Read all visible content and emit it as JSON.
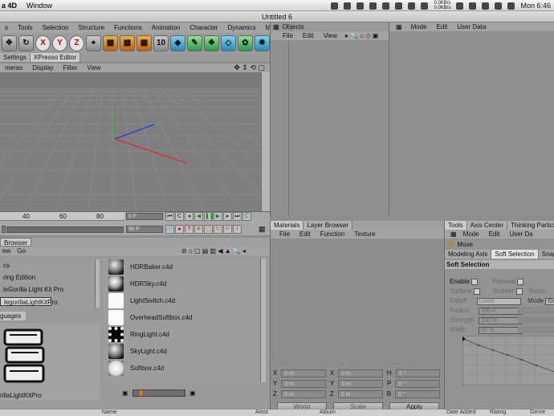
{
  "menubar": {
    "app_name": "a 4D",
    "items": [
      "Window"
    ],
    "network": {
      "up": "0.0KB/s",
      "down": "0.0KB/s"
    },
    "clock": "Mon 6:46"
  },
  "window": {
    "title": "Untitled 6"
  },
  "main_menu": [
    "s",
    "Tools",
    "Selection",
    "Structure",
    "Functions",
    "Animation",
    "Character",
    "Dynamics",
    "MoC"
  ],
  "toolbar": {
    "x_label": "X",
    "y_label": "Y",
    "z_label": "Z",
    "counter": "10"
  },
  "left_tabs": [
    "Settings",
    "XPresso Editor"
  ],
  "viewport_menu": [
    "meras",
    "Display",
    "Filter",
    "View"
  ],
  "timeline": {
    "ruler": [
      "40",
      "60",
      "80"
    ],
    "current_frame": "0 F",
    "end_frame": "90 F",
    "min_frame": "0 F",
    "max_frame": "90 F"
  },
  "content_browser": {
    "tab": "Browser",
    "menu": [
      "ew",
      "Go"
    ],
    "tree": [
      {
        "label": "cs",
        "selected": false
      },
      {
        "label": "ring Edition",
        "selected": false
      },
      {
        "label": "leGorilla Light Kit Pro",
        "selected": false
      },
      {
        "label": "legorillaLightKitPro",
        "selected": true
      }
    ],
    "languages_label": "guages",
    "preview_caption": "rillaLightKitPro",
    "files": [
      {
        "name": "HDRBaker.c4d",
        "thumb": "sphere"
      },
      {
        "name": "HDRSky.c4d",
        "thumb": "sky"
      },
      {
        "name": "LightSwitch.c4d",
        "thumb": "light"
      },
      {
        "name": "OverheadSoftbox.c4d",
        "thumb": "light"
      },
      {
        "name": "RingLight.c4d",
        "thumb": "ring"
      },
      {
        "name": "SkyLight.c4d",
        "thumb": "sphere"
      },
      {
        "name": "Softbox.c4d",
        "thumb": "soft"
      }
    ]
  },
  "objects_panel": {
    "title": "Objects",
    "menu": [
      "File",
      "Edit",
      "View"
    ]
  },
  "attributes_panel": {
    "menu": [
      "Mode",
      "Edit",
      "User Data"
    ]
  },
  "materials_panel": {
    "tabs": [
      "Materials",
      "Layer Browser"
    ],
    "menu": [
      "File",
      "Edit",
      "Function",
      "Texture"
    ]
  },
  "coordinates": {
    "col_headers": [
      "---",
      "---",
      "---"
    ],
    "rows": [
      {
        "a": "X",
        "av": "0 m",
        "b": "X",
        "bv": "0 m",
        "c": "H",
        "cv": "0 °"
      },
      {
        "a": "Y",
        "av": "0 m",
        "b": "Y",
        "bv": "0 m",
        "c": "P",
        "cv": "0 °"
      },
      {
        "a": "Z",
        "av": "0 m",
        "b": "Z",
        "bv": "0 m",
        "c": "B",
        "cv": "0 °"
      }
    ],
    "world": "World",
    "scale": "Scale",
    "apply": "Apply"
  },
  "tools_panel": {
    "tabs": [
      "Tools",
      "Axis Center",
      "Thinking Particles"
    ],
    "menu": [
      "Mode",
      "Edit",
      "User Da"
    ],
    "tool_name": "Move",
    "sub_tabs": [
      "Modeling Axis",
      "Soft Selection",
      "Snap Se"
    ],
    "section": "Soft Selection",
    "enable": "Enable",
    "preview": "Preview",
    "surface": "Surface",
    "rubber": "Rubber",
    "restrict": "Restri",
    "falloff": "Falloff",
    "falloff_value": "Linear",
    "mode": "Mode",
    "mode_value": "Gr",
    "radius": "Radius",
    "radius_value": "100 m",
    "strength": "Strength",
    "strength_value": "100 %",
    "width": "Width",
    "width_value": "50 %"
  },
  "bottom_strip": [
    "Name",
    "Artist",
    "Album",
    "Date Added",
    "Rating",
    "Genre"
  ]
}
